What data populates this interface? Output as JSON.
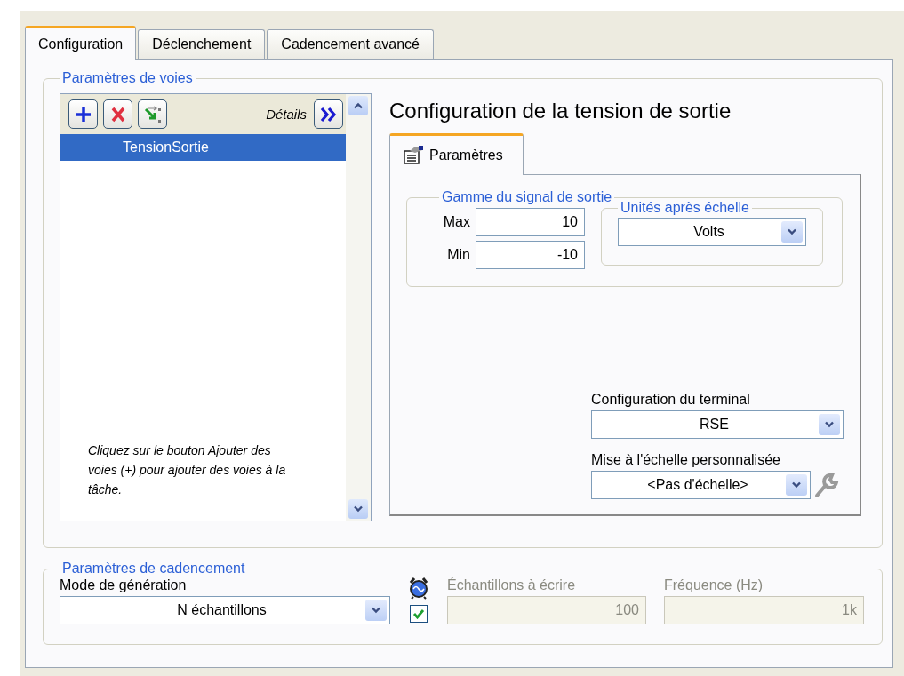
{
  "tabs": [
    {
      "label": "Configuration",
      "selected": true
    },
    {
      "label": "Déclenchement",
      "selected": false
    },
    {
      "label": "Cadencement avancé",
      "selected": false
    }
  ],
  "channel_settings": {
    "legend": "Paramètres de voies",
    "details_label": "Détails",
    "channels": [
      {
        "name": "TensionSortie",
        "selected": true
      }
    ],
    "hint": "Cliquez sur le bouton Ajouter des voies (+) pour ajouter des voies à la tâche."
  },
  "channel_config": {
    "title": "Configuration de la tension de sortie",
    "tabs": [
      {
        "label": "Paramètres",
        "selected": true
      }
    ],
    "range": {
      "legend": "Gamme du signal de sortie",
      "max_label": "Max",
      "max_value": "10",
      "min_label": "Min",
      "min_value": "-10"
    },
    "units": {
      "legend": "Unités après échelle",
      "value": "Volts"
    },
    "terminal": {
      "label": "Configuration du terminal",
      "value": "RSE"
    },
    "scaling": {
      "label": "Mise à l'échelle personnalisée",
      "value": "<Pas d'échelle>"
    }
  },
  "timing": {
    "legend": "Paramètres de cadencement",
    "mode": {
      "label": "Mode de génération",
      "value": "N échantillons"
    },
    "timing_enabled": {
      "checked": true
    },
    "samples": {
      "label": "Échantillons à écrire",
      "value": "100",
      "disabled": true
    },
    "rate": {
      "label": "Fréquence (Hz)",
      "value": "1k",
      "disabled": true
    }
  }
}
